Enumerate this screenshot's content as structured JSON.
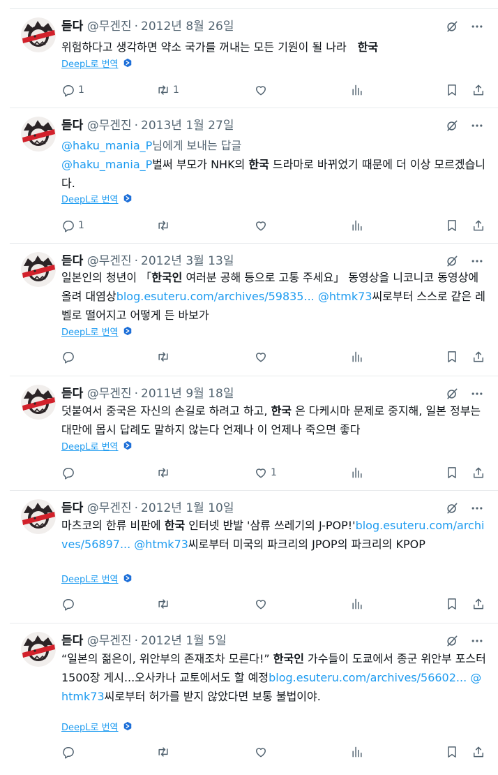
{
  "translate_label": "DeepL로 번역",
  "colors": {
    "accent": "#1d9bf0",
    "secondary_text": "#536471",
    "divider": "#e8ebed"
  },
  "tweets": [
    {
      "name": "듣다",
      "handle": "@무겐진",
      "date": "2012년 8월 26일",
      "text_segments": [
        {
          "text": "위험하다고 생각하면 약소 국가를 꺼내는 모든 기원이 될 나라　",
          "style": "normal"
        },
        {
          "text": "한국",
          "style": "bold"
        }
      ],
      "reply_count": "1",
      "retweet_count": "1",
      "like_count": ""
    },
    {
      "name": "듣다",
      "handle": "@무겐진",
      "date": "2013년 1월 27일",
      "reply_to_segments": [
        {
          "text": "@haku_mania_P",
          "style": "link"
        },
        {
          "text": "님에게 보내는 답글",
          "style": "normal"
        }
      ],
      "text_segments": [
        {
          "text": "@haku_mania_P",
          "style": "link"
        },
        {
          "text": "벌써 부모가 NHK의 ",
          "style": "normal"
        },
        {
          "text": "한국",
          "style": "bold"
        },
        {
          "text": " 드라마로 바뀌었기 때문에 더 이상 모르겠습니다.",
          "style": "normal"
        }
      ],
      "reply_count": "1",
      "retweet_count": "",
      "like_count": ""
    },
    {
      "name": "듣다",
      "handle": "@무겐진",
      "date": "2012년 3월 13일",
      "text_segments": [
        {
          "text": "일본인의 청년이 「",
          "style": "normal"
        },
        {
          "text": "한국인",
          "style": "bold"
        },
        {
          "text": " 여러분 공해 등으로 고통 주세요」 동영상을 니코니코 동영상에 올려 대염상",
          "style": "normal"
        },
        {
          "text": "blog.esuteru.com/archives/59835...",
          "style": "link"
        },
        {
          "text": " ",
          "style": "normal"
        },
        {
          "text": "@htmk73",
          "style": "link"
        },
        {
          "text": "씨로부터 스스로 같은 레벨로 떨어지고 어떻게 든 바보가",
          "style": "normal"
        }
      ],
      "reply_count": "",
      "retweet_count": "",
      "like_count": ""
    },
    {
      "name": "듣다",
      "handle": "@무겐진",
      "date": "2011년 9월 18일",
      "text_segments": [
        {
          "text": "덧붙여서 중국은 자신의 손길로 하려고 하고, ",
          "style": "normal"
        },
        {
          "text": "한국",
          "style": "bold"
        },
        {
          "text": " 은 다케시마 문제로 중지해, 일본 정부는 대만에 몹시 답례도 말하지 않는다 언제나 이 언제나 죽으면 좋다",
          "style": "normal"
        }
      ],
      "reply_count": "",
      "retweet_count": "",
      "like_count": "1"
    },
    {
      "name": "듣다",
      "handle": "@무겐진",
      "date": "2012년 1월 10일",
      "text_segments": [
        {
          "text": "마츠코의 한류 비판에 ",
          "style": "normal"
        },
        {
          "text": "한국",
          "style": "bold"
        },
        {
          "text": " 인터넷 반발 '삼류 쓰레기의 J-POP!'",
          "style": "normal"
        },
        {
          "text": "blog.esuteru.com/archives/56897...",
          "style": "link"
        },
        {
          "text": " ",
          "style": "normal"
        },
        {
          "text": "@htmk73",
          "style": "link"
        },
        {
          "text": "씨로부터 미국의 파크리의 JPOP의 파크리의 KPOP",
          "style": "normal"
        }
      ],
      "reply_count": "",
      "retweet_count": "",
      "like_count": ""
    },
    {
      "name": "듣다",
      "handle": "@무겐진",
      "date": "2012년 1월 5일",
      "text_segments": [
        {
          "text": "“일본의 젊은이, 위안부의 존재조차 모른다!” ",
          "style": "normal"
        },
        {
          "text": "한국인",
          "style": "bold"
        },
        {
          "text": " 가수들이 도쿄에서 종군 위안부 포스터 1500장 게시...오사카나 교토에서도 할 예정",
          "style": "normal"
        },
        {
          "text": "blog.esuteru.com/archives/56602...",
          "style": "link"
        },
        {
          "text": " ",
          "style": "normal"
        },
        {
          "text": "@htmk73",
          "style": "link"
        },
        {
          "text": "씨로부터 허가를 받지 않았다면 보통 불법이야.",
          "style": "normal"
        }
      ],
      "reply_count": "",
      "retweet_count": "",
      "like_count": ""
    }
  ]
}
